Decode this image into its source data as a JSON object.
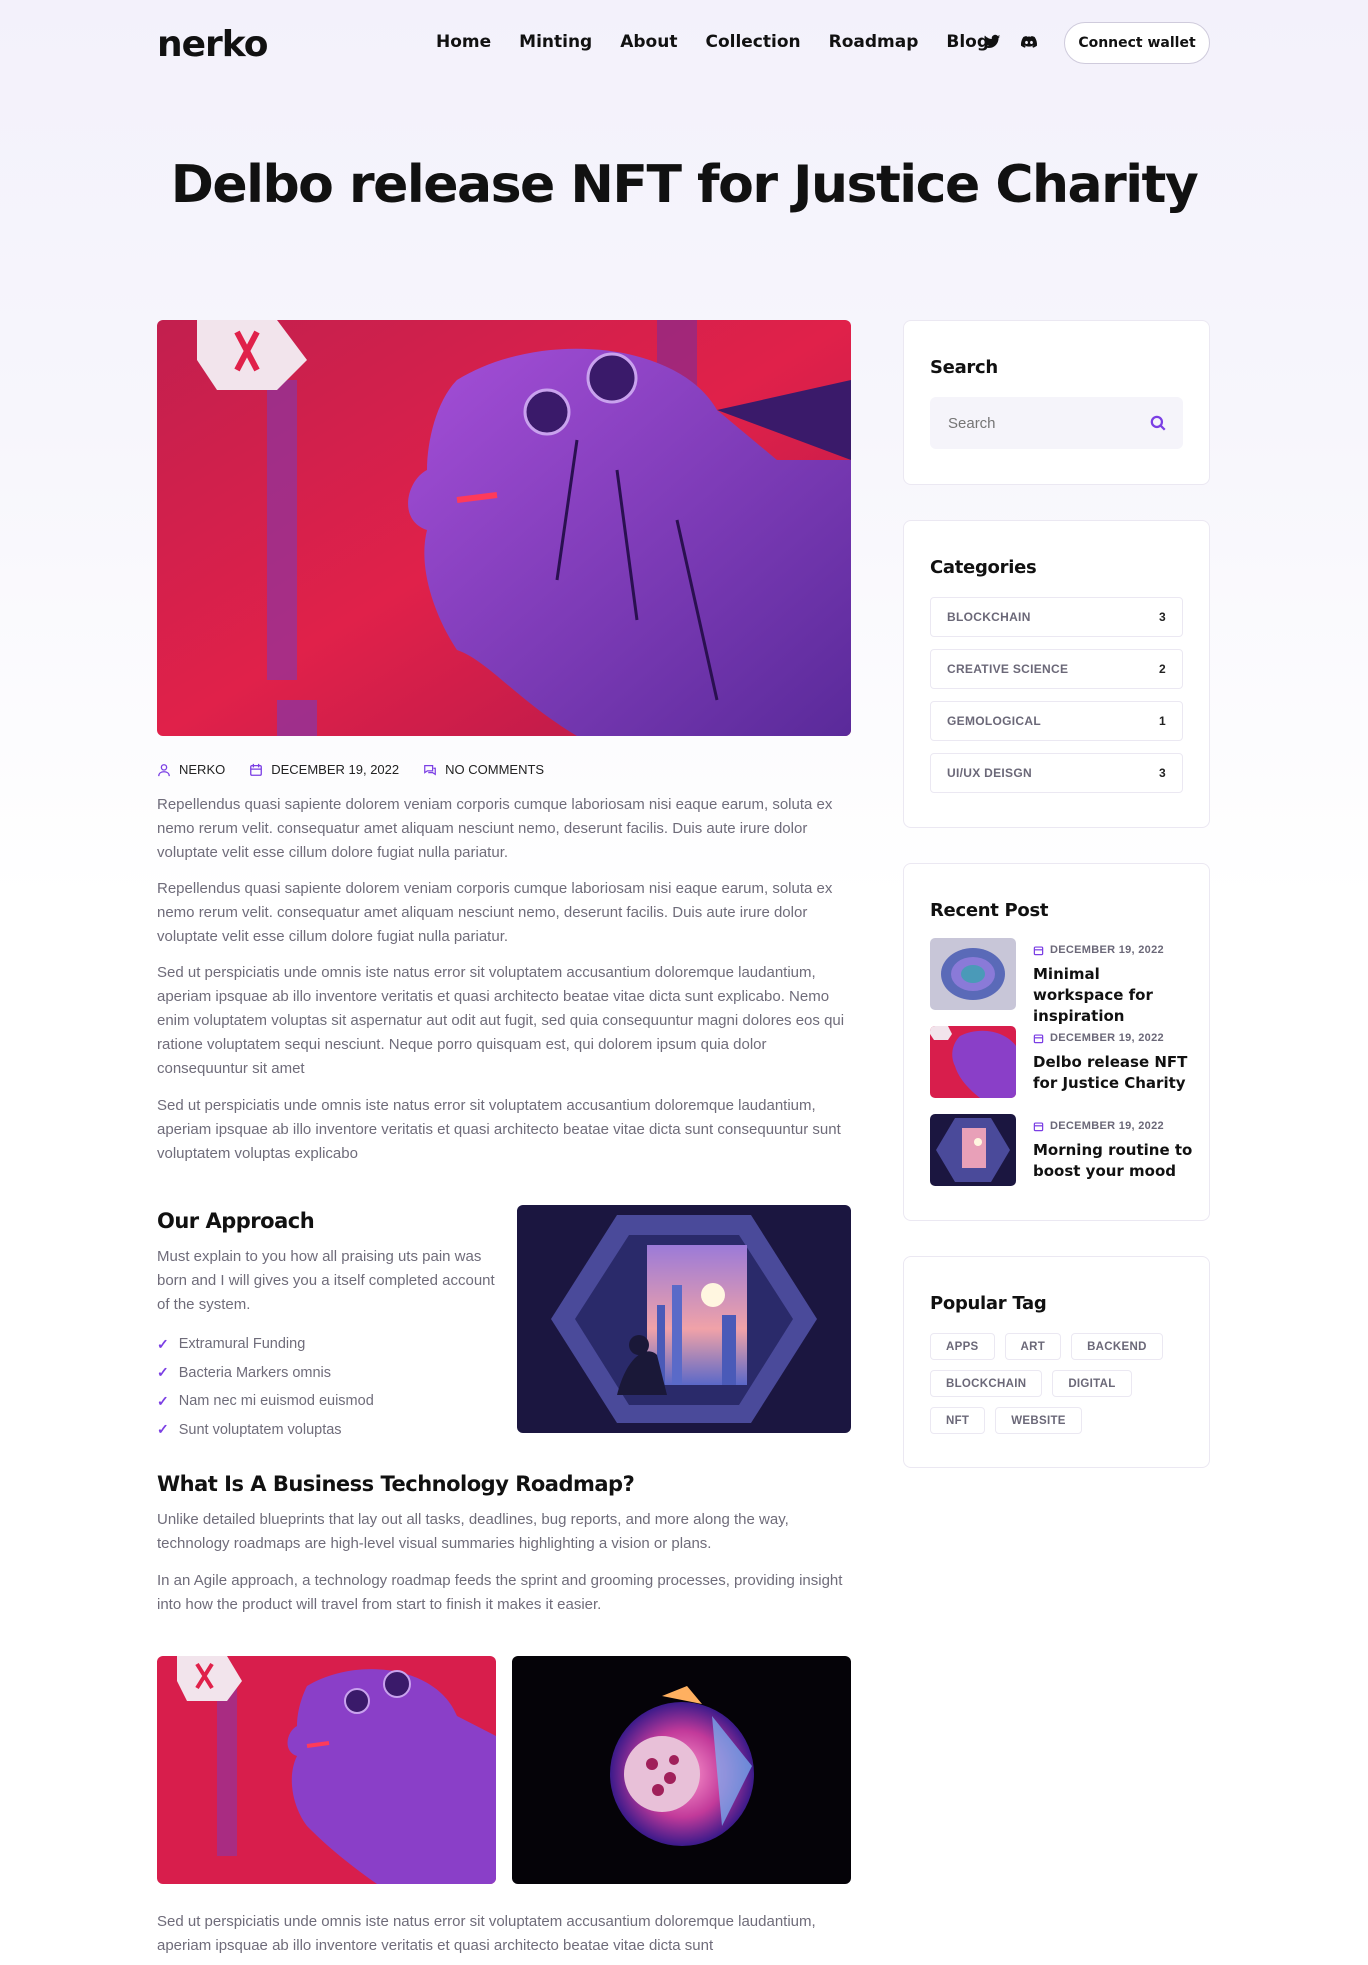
{
  "header": {
    "logo": "nerko",
    "nav": [
      "Home",
      "Minting",
      "About",
      "Collection",
      "Roadmap",
      "Blog"
    ],
    "connect_label": "Connect wallet"
  },
  "page_title": "Delbo release NFT for Justice Charity",
  "meta": {
    "author": "NERKO",
    "date": "DECEMBER 19, 2022",
    "comments": "NO COMMENTS"
  },
  "body": {
    "p1": "Repellendus quasi sapiente dolorem veniam corporis cumque laboriosam nisi eaque earum, soluta ex nemo rerum velit. consequatur amet aliquam nesciunt nemo, deserunt facilis. Duis aute irure dolor voluptate velit esse cillum dolore fugiat nulla pariatur.",
    "p2": "Repellendus quasi sapiente dolorem veniam corporis cumque laboriosam nisi eaque earum, soluta ex nemo rerum velit. consequatur amet aliquam nesciunt nemo, deserunt facilis. Duis aute irure dolor voluptate velit esse cillum dolore fugiat nulla pariatur.",
    "p3": "Sed ut perspiciatis unde omnis iste natus error sit voluptatem accusantium doloremque laudantium, aperiam ipsquae ab illo inventore veritatis et quasi architecto beatae vitae dicta sunt explicabo. Nemo enim voluptatem voluptas sit aspernatur aut odit aut fugit, sed quia consequuntur magni dolores eos qui ratione voluptatem sequi nesciunt. Neque porro quisquam est, qui dolorem ipsum quia dolor consequuntur sit amet",
    "p4": "Sed ut perspiciatis unde omnis iste natus error sit voluptatem accusantium doloremque laudantium, aperiam ipsquae ab illo inventore veritatis et quasi architecto beatae vitae dicta sunt consequuntur sunt voluptatem voluptas explicabo",
    "approach_title": "Our Approach",
    "approach_text": "Must explain to you how all praising uts pain was born and I will gives you a itself completed account of the system.",
    "checklist": [
      "Extramural Funding",
      "Bacteria Markers omnis",
      "Nam nec mi euismod euismod",
      "Sunt voluptatem voluptas"
    ],
    "roadmap_title": "What Is A Business Technology Roadmap?",
    "roadmap_p1": "Unlike detailed blueprints that lay out all tasks, deadlines, bug reports, and more along the way, technology roadmaps are high-level visual summaries highlighting a vision or plans.",
    "roadmap_p2": "In an Agile approach, a technology roadmap feeds the sprint and grooming processes, providing insight into how the product will travel from start to finish it makes it easier.",
    "p5": "Sed ut perspiciatis unde omnis iste natus error sit voluptatem accusantium doloremque laudantium, aperiam ipsquae ab illo inventore veritatis et quasi architecto beatae vitae dicta sunt"
  },
  "sidebar": {
    "search_title": "Search",
    "search_placeholder": "Search",
    "categories_title": "Categories",
    "categories": [
      {
        "label": "BLOCKCHAIN",
        "count": "3"
      },
      {
        "label": "CREATIVE SCIENCE",
        "count": "2"
      },
      {
        "label": "GEMOLOGICAL",
        "count": "1"
      },
      {
        "label": "UI/UX DEISGN",
        "count": "3"
      }
    ],
    "recent_title": "Recent Post",
    "recent": [
      {
        "date": "DECEMBER 19, 2022",
        "title": "Minimal workspace for inspiration"
      },
      {
        "date": "DECEMBER 19, 2022",
        "title": "Delbo release NFT for Justice Charity"
      },
      {
        "date": "DECEMBER 19, 2022",
        "title": "Morning routine to boost your mood"
      }
    ],
    "tags_title": "Popular Tag",
    "tags": [
      "APPS",
      "ART",
      "BACKEND",
      "BLOCKCHAIN",
      "DIGITAL",
      "NFT",
      "WEBSITE"
    ]
  },
  "colors": {
    "accent": "#7b3fe4",
    "muted_text": "#6f6c7a",
    "border": "#ebe8f2"
  },
  "icons": [
    "twitter-icon",
    "discord-icon",
    "user-icon",
    "calendar-icon",
    "comments-icon",
    "search-icon",
    "check-icon"
  ]
}
